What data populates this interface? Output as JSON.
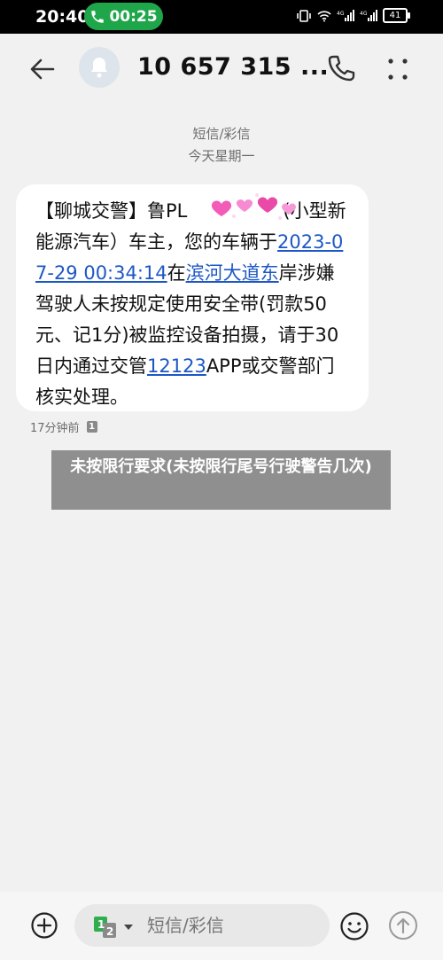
{
  "status_bar": {
    "time": "20:40",
    "call_duration": "00:25",
    "signal_label": "4G",
    "battery": "41"
  },
  "header": {
    "title": "10 657 315 ...",
    "icons": [
      "back-arrow-icon",
      "avatar-bell-icon",
      "phone-icon",
      "more-icon"
    ]
  },
  "conversation": {
    "channel": "短信/彩信",
    "date": "今天星期一"
  },
  "message": {
    "seg1": "【聊城交警】鲁PL",
    "seg2": "(小型新能源汽车）车主，您的车辆于",
    "link_datetime": "2023-07-29 00:34:14",
    "seg3": "在",
    "link_place": "滨河大道东",
    "seg4": "岸涉嫌驾驶人未按规定使用安全带(罚款50元、记1分)被监控设备拍摄，请于30日内通过交管",
    "link_app": "12123",
    "seg5": "APP或交警部门核实处理。",
    "time": "17分钟前",
    "sim": "1"
  },
  "caption": "未按限行要求(未按限行尾号行驶警告几次)",
  "composer": {
    "placeholder": "短信/彩信",
    "sim_primary": "1",
    "sim_secondary": "2"
  },
  "colors": {
    "link": "#1d57c6",
    "call_pill": "#1fa64a",
    "sim_green": "#2fae4e",
    "caption_bg": "#8f8f8f"
  }
}
